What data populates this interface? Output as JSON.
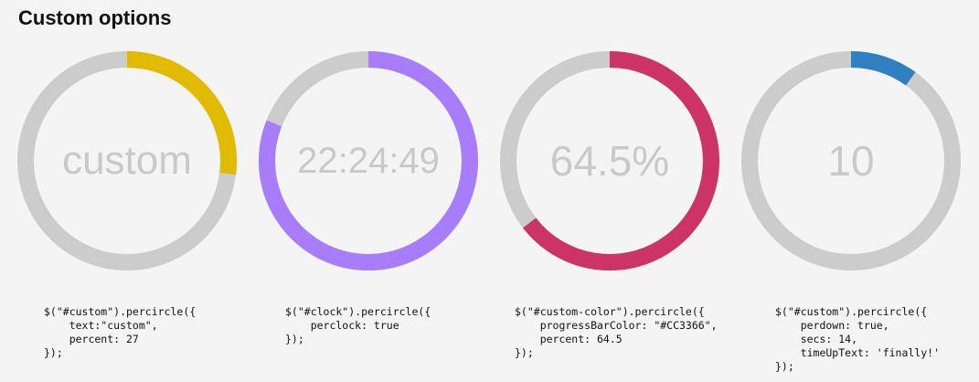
{
  "page": {
    "title": "Custom options"
  },
  "track_color": "#cccccc",
  "widgets": [
    {
      "label": "custom",
      "percent": 27,
      "color": "#e0bb00",
      "code": "$(\"#custom\").percircle({\n    text:\"custom\",\n    percent: 27\n});"
    },
    {
      "label": "22:24:49",
      "percent": 81,
      "color": "#a87dfc",
      "code": "$(\"#clock\").percircle({\n    perclock: true\n});"
    },
    {
      "label": "64.5%",
      "percent": 64.5,
      "color": "#cc3366",
      "code": "$(\"#custom-color\").percircle({\n    progressBarColor: \"#CC3366\",\n    percent: 64.5\n});"
    },
    {
      "label": "10",
      "percent": 10,
      "color": "#2f7fc1",
      "code": "$(\"#custom\").percircle({\n    perdown: true,\n    secs: 14,\n    timeUpText: 'finally!'\n});"
    }
  ]
}
